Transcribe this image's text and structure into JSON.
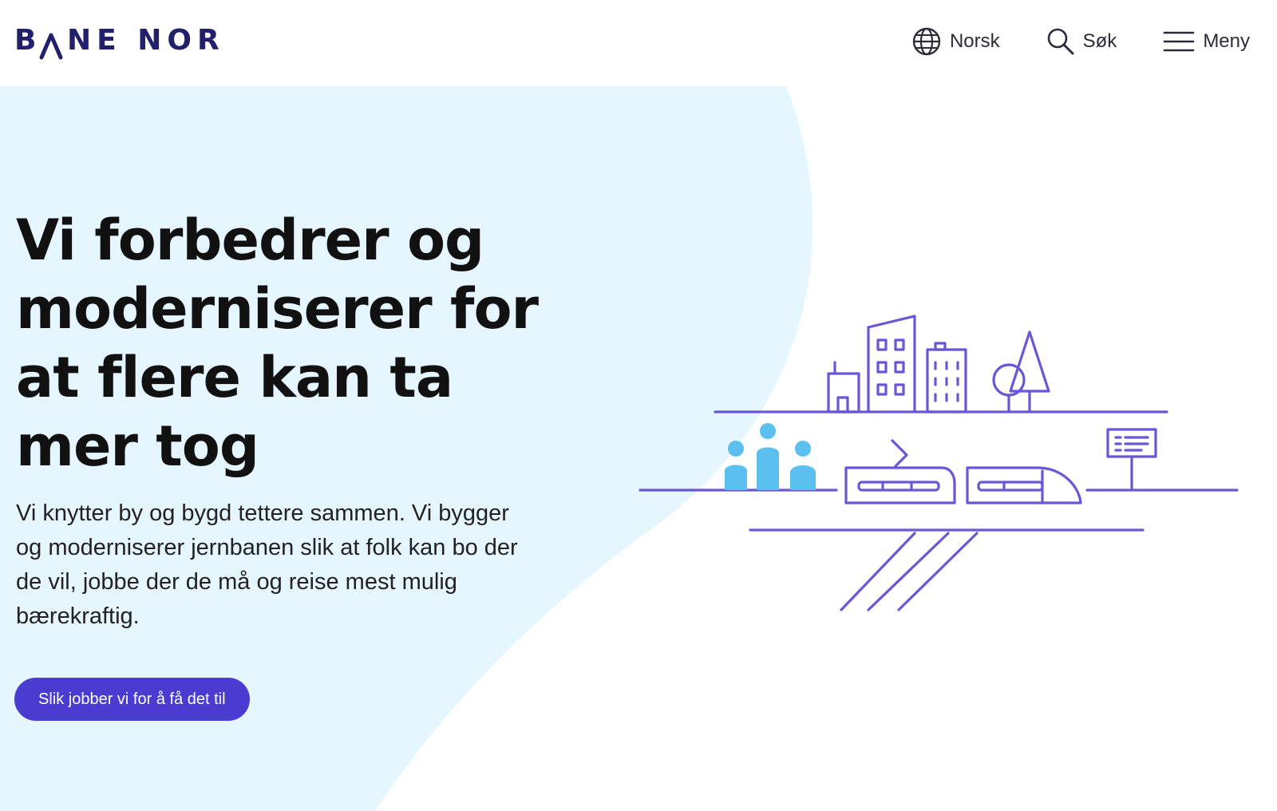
{
  "brand": {
    "logo_text": "BANE NOR",
    "primary_color": "#22206b",
    "accent_color": "#4a3bd1",
    "hero_bg_color": "#e6f6fe",
    "illustration_line_color": "#6a56d6",
    "people_color": "#5bc0f0"
  },
  "header": {
    "nav": [
      {
        "label": "Norsk",
        "icon": "globe-icon"
      },
      {
        "label": "Søk",
        "icon": "search-icon"
      },
      {
        "label": "Meny",
        "icon": "hamburger-menu-icon"
      }
    ]
  },
  "hero": {
    "title": "Vi forbedrer og moderniserer for at flere kan ta mer tog",
    "lead": "Vi knytter by og bygd tettere sammen. Vi bygger og moderniserer jernbanen slik at folk kan bo der de vil, jobbe der de må og reise mest mulig bærekraftig.",
    "cta_label": "Slik jobber vi for å få det til"
  }
}
